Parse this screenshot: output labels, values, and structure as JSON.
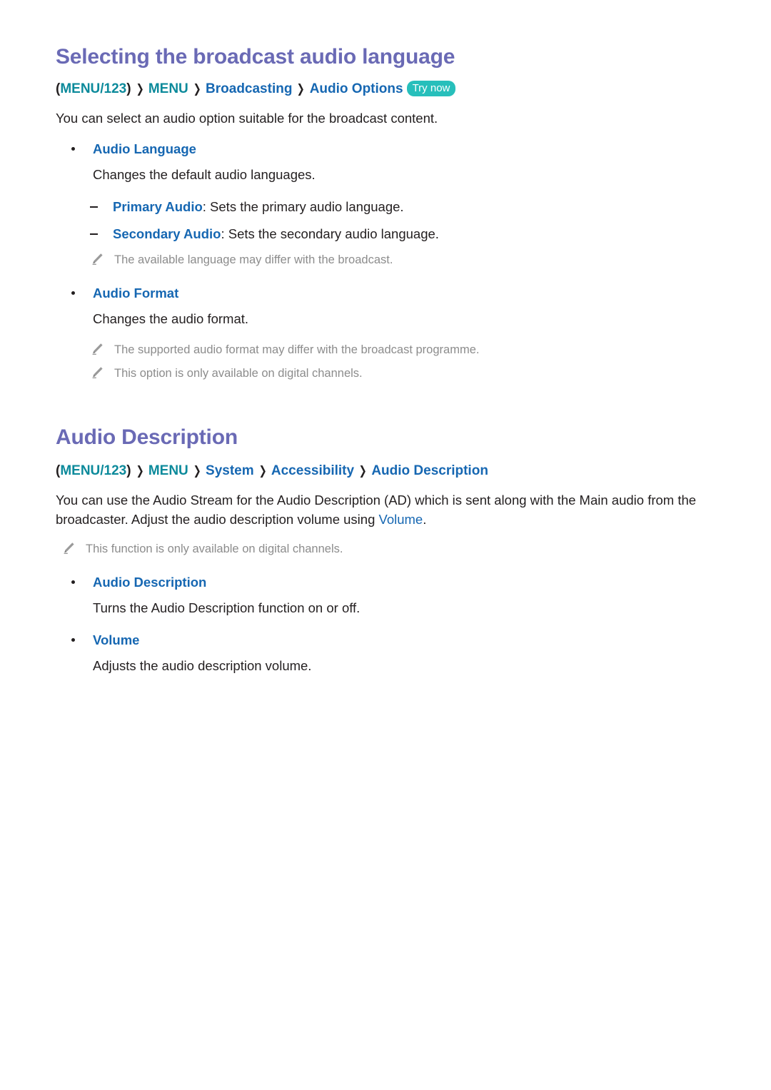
{
  "document": {
    "sections": [
      {
        "id": "broadcast-audio-language",
        "heading": "Selecting the broadcast audio language",
        "breadcrumb": {
          "open_paren": "(",
          "first": "MENU/123",
          "close_paren": ")",
          "separator": "❯",
          "items": [
            "MENU",
            "Broadcasting",
            "Audio Options"
          ],
          "badge": "Try now"
        },
        "intro": "You can select an audio option suitable for the broadcast content.",
        "bullets": [
          {
            "label": "Audio Language",
            "description": "Changes the default audio languages.",
            "sub_items": [
              {
                "term": "Primary Audio",
                "sep": ": ",
                "text": "Sets the primary audio language."
              },
              {
                "term": "Secondary Audio",
                "sep": ": ",
                "text": "Sets the secondary audio language."
              }
            ],
            "notes": [
              "The available language may differ with the broadcast."
            ]
          },
          {
            "label": "Audio Format",
            "description": "Changes the audio format.",
            "sub_items": [],
            "notes": [
              "The supported audio format may differ with the broadcast programme.",
              "This option is only available on digital channels."
            ]
          }
        ]
      },
      {
        "id": "audio-description",
        "heading": "Audio Description",
        "breadcrumb": {
          "open_paren": "(",
          "first": "MENU/123",
          "close_paren": ")",
          "separator": "❯",
          "items": [
            "MENU",
            "System",
            "Accessibility",
            "Audio Description"
          ],
          "badge": ""
        },
        "intro_part1": "You can use the Audio Stream for the Audio Description (AD) which is sent along with the Main audio from the broadcaster. Adjust the audio description volume using ",
        "intro_link": "Volume",
        "intro_part2": ".",
        "notes": [
          "This function is only available on digital channels."
        ],
        "bullets": [
          {
            "label": "Audio Description",
            "description": "Turns the Audio Description function on or off."
          },
          {
            "label": "Volume",
            "description": "Adjusts the audio description volume."
          }
        ]
      }
    ]
  },
  "colors": {
    "heading": "#6a6ab5",
    "teal": "#0c8a9b",
    "blue": "#1667b2",
    "badge_bg": "#27bfbb",
    "body": "#231f20",
    "note": "#8c8c8c"
  },
  "icons": {
    "pencil": "pencil-note-icon",
    "chevron": "chevron-right-icon"
  }
}
